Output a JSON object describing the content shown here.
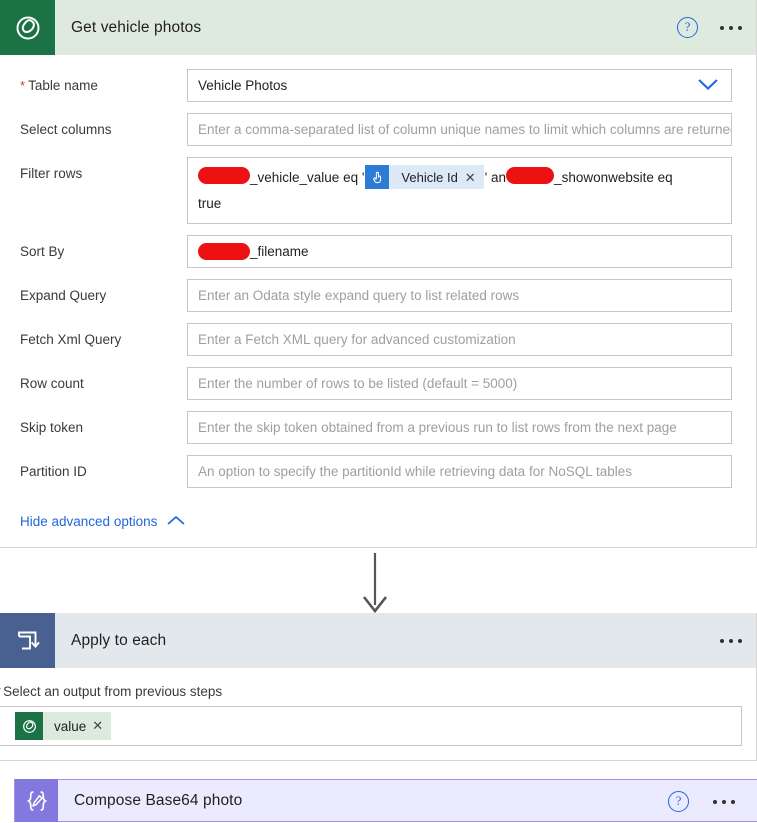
{
  "action_card": {
    "title": "Get vehicle photos",
    "icon": "dataverse-icon",
    "help_label": "?",
    "more_label": "...",
    "fields": [
      {
        "label": "Table name",
        "required": true,
        "value": "Vehicle Photos",
        "placeholder": "",
        "control": "dropdown"
      },
      {
        "label": "Select columns",
        "required": false,
        "value": "",
        "placeholder": "Enter a comma-separated list of column unique names to limit which columns are returned",
        "control": "text"
      },
      {
        "label": "Sort By",
        "required": false,
        "value": "_filename",
        "placeholder": "",
        "control": "redacted-text"
      },
      {
        "label": "Expand Query",
        "required": false,
        "value": "",
        "placeholder": "Enter an Odata style expand query to list related rows",
        "control": "text"
      },
      {
        "label": "Fetch Xml Query",
        "required": false,
        "value": "",
        "placeholder": "Enter a Fetch XML query for advanced customization",
        "control": "text"
      },
      {
        "label": "Row count",
        "required": false,
        "value": "",
        "placeholder": "Enter the number of rows to be listed (default = 5000)",
        "control": "text"
      },
      {
        "label": "Skip token",
        "required": false,
        "value": "",
        "placeholder": "Enter the skip token obtained from a previous run to list rows from the next page",
        "control": "text"
      },
      {
        "label": "Partition ID",
        "required": false,
        "value": "",
        "placeholder": "An option to specify the partitionId while retrieving data for NoSQL tables",
        "control": "text"
      }
    ],
    "filter_rows": {
      "label": "Filter rows",
      "part1": "_vehicle_value eq '",
      "token_label": "Vehicle Id",
      "token_icon": "manual-trigger-icon",
      "token_remove": "✕",
      "part2": "' an",
      "part3": "_showonwebsite eq",
      "part4": "true"
    },
    "advanced_toggle": {
      "label": "Hide advanced options",
      "icon": "chevron-up-icon"
    }
  },
  "loop_card": {
    "title": "Apply to each",
    "icon": "loop-icon",
    "more_label": "...",
    "subtitle": "Select an output from previous steps",
    "required": true,
    "token": {
      "label": "value",
      "icon": "dataverse-icon",
      "remove": "✕"
    }
  },
  "compose_card": {
    "title": "Compose Base64 photo",
    "icon": "compose-icon",
    "help_label": "?",
    "more_label": "..."
  },
  "colors": {
    "dataverse_green": "#1a7245",
    "dataverse_header": "#dfeade",
    "loop_blue": "#486191",
    "loop_header": "#e3e8ed",
    "compose_purple": "#8378de",
    "compose_header": "#eceaff",
    "link_blue": "#2266dd",
    "redaction_red": "#ee1111",
    "required_red": "#d93a2a"
  }
}
